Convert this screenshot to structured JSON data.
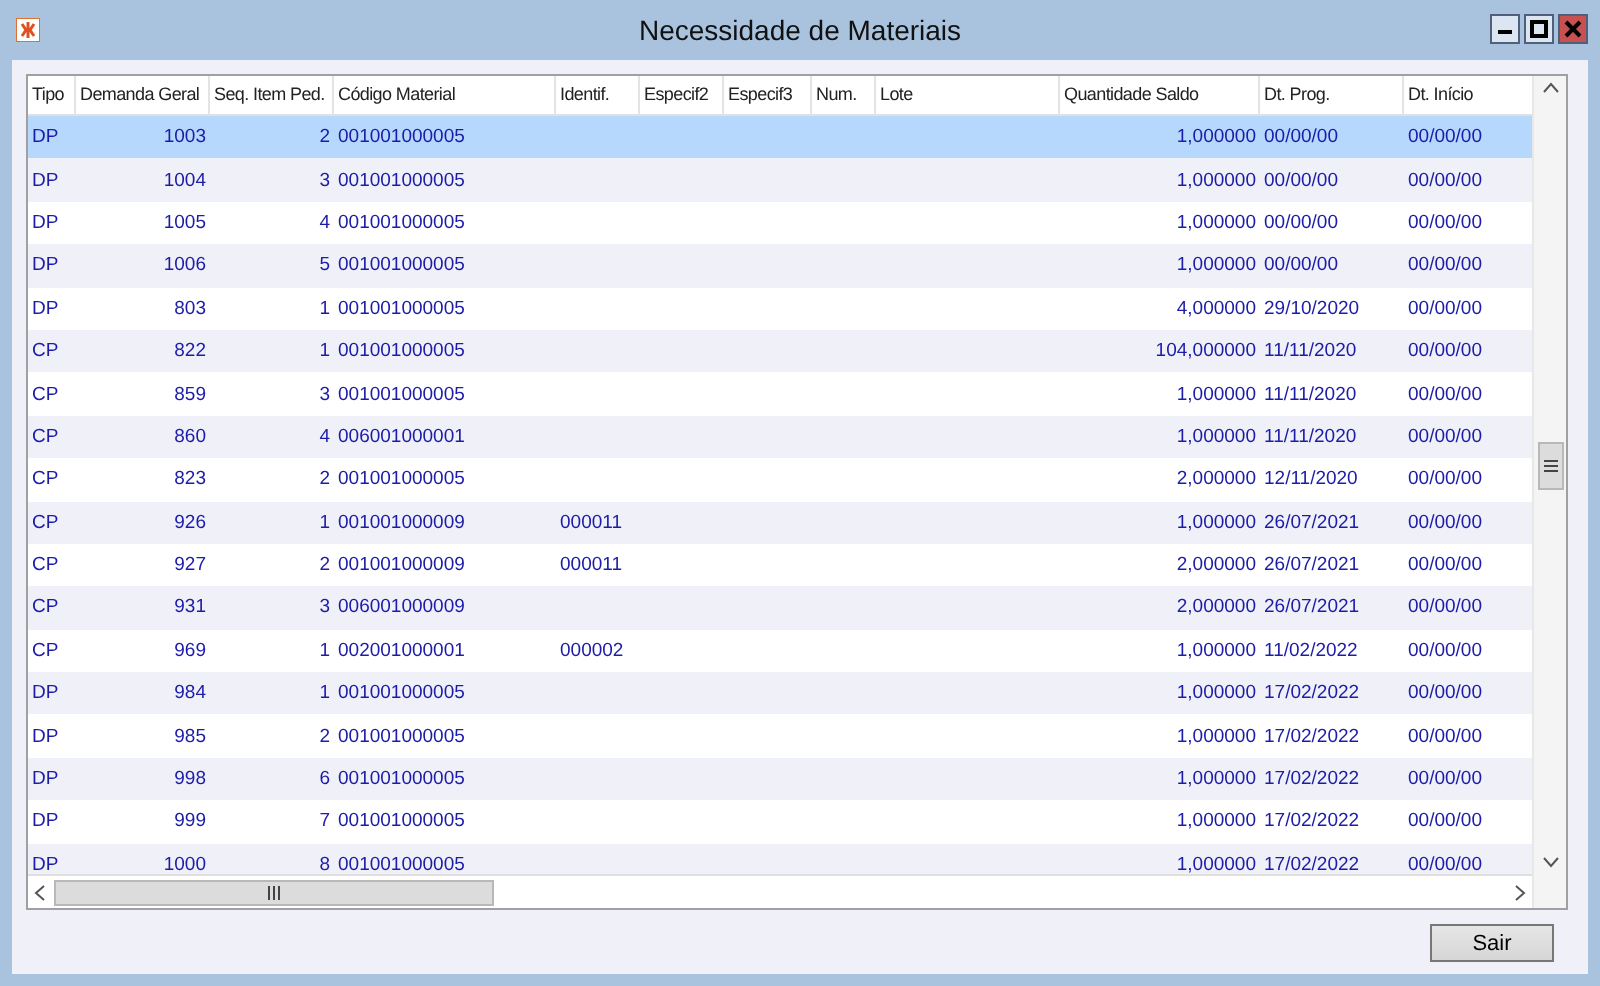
{
  "window": {
    "title": "Necessidade de Materiais"
  },
  "table": {
    "columns": [
      "Tipo",
      "Demanda Geral",
      "Seq. Item Ped.",
      "Código Material",
      "Identif.",
      "Especif2",
      "Especif3",
      "Num.",
      "Lote",
      "Quantidade Saldo",
      "Dt. Prog.",
      "Dt. Início"
    ],
    "rows": [
      {
        "selected": true,
        "tipo": "DP",
        "demanda_geral": "1003",
        "seq_item_ped": "2",
        "codigo_material": "001001000005",
        "quantidade_saldo": "1,000000",
        "dt_prog": "00/00/00",
        "dt_inicio": "00/00/00"
      },
      {
        "selected": false,
        "tipo": "DP",
        "demanda_geral": "1004",
        "seq_item_ped": "3",
        "codigo_material": "001001000005",
        "quantidade_saldo": "1,000000",
        "dt_prog": "00/00/00",
        "dt_inicio": "00/00/00"
      },
      {
        "selected": false,
        "tipo": "DP",
        "demanda_geral": "1005",
        "seq_item_ped": "4",
        "codigo_material": "001001000005",
        "quantidade_saldo": "1,000000",
        "dt_prog": "00/00/00",
        "dt_inicio": "00/00/00"
      },
      {
        "selected": false,
        "tipo": "DP",
        "demanda_geral": "1006",
        "seq_item_ped": "5",
        "codigo_material": "001001000005",
        "quantidade_saldo": "1,000000",
        "dt_prog": "00/00/00",
        "dt_inicio": "00/00/00"
      },
      {
        "selected": false,
        "tipo": "DP",
        "demanda_geral": "803",
        "seq_item_ped": "1",
        "codigo_material": "001001000005",
        "quantidade_saldo": "4,000000",
        "dt_prog": "29/10/2020",
        "dt_inicio": "00/00/00"
      },
      {
        "selected": false,
        "tipo": "CP",
        "demanda_geral": "822",
        "seq_item_ped": "1",
        "codigo_material": "001001000005",
        "quantidade_saldo": "104,000000",
        "dt_prog": "11/11/2020",
        "dt_inicio": "00/00/00"
      },
      {
        "selected": false,
        "tipo": "CP",
        "demanda_geral": "859",
        "seq_item_ped": "3",
        "codigo_material": "001001000005",
        "quantidade_saldo": "1,000000",
        "dt_prog": "11/11/2020",
        "dt_inicio": "00/00/00"
      },
      {
        "selected": false,
        "tipo": "CP",
        "demanda_geral": "860",
        "seq_item_ped": "4",
        "codigo_material": "006001000001",
        "quantidade_saldo": "1,000000",
        "dt_prog": "11/11/2020",
        "dt_inicio": "00/00/00"
      },
      {
        "selected": false,
        "tipo": "CP",
        "demanda_geral": "823",
        "seq_item_ped": "2",
        "codigo_material": "001001000005",
        "quantidade_saldo": "2,000000",
        "dt_prog": "12/11/2020",
        "dt_inicio": "00/00/00"
      },
      {
        "selected": false,
        "tipo": "CP",
        "demanda_geral": "926",
        "seq_item_ped": "1",
        "codigo_material": "001001000009",
        "identif": "000011",
        "quantidade_saldo": "1,000000",
        "dt_prog": "26/07/2021",
        "dt_inicio": "00/00/00"
      },
      {
        "selected": false,
        "tipo": "CP",
        "demanda_geral": "927",
        "seq_item_ped": "2",
        "codigo_material": "001001000009",
        "identif": "000011",
        "quantidade_saldo": "2,000000",
        "dt_prog": "26/07/2021",
        "dt_inicio": "00/00/00"
      },
      {
        "selected": false,
        "tipo": "CP",
        "demanda_geral": "931",
        "seq_item_ped": "3",
        "codigo_material": "006001000009",
        "quantidade_saldo": "2,000000",
        "dt_prog": "26/07/2021",
        "dt_inicio": "00/00/00"
      },
      {
        "selected": false,
        "tipo": "CP",
        "demanda_geral": "969",
        "seq_item_ped": "1",
        "codigo_material": "002001000001",
        "identif": "000002",
        "quantidade_saldo": "1,000000",
        "dt_prog": "11/02/2022",
        "dt_inicio": "00/00/00"
      },
      {
        "selected": false,
        "tipo": "DP",
        "demanda_geral": "984",
        "seq_item_ped": "1",
        "codigo_material": "001001000005",
        "quantidade_saldo": "1,000000",
        "dt_prog": "17/02/2022",
        "dt_inicio": "00/00/00"
      },
      {
        "selected": false,
        "tipo": "DP",
        "demanda_geral": "985",
        "seq_item_ped": "2",
        "codigo_material": "001001000005",
        "quantidade_saldo": "1,000000",
        "dt_prog": "17/02/2022",
        "dt_inicio": "00/00/00"
      },
      {
        "selected": false,
        "tipo": "DP",
        "demanda_geral": "998",
        "seq_item_ped": "6",
        "codigo_material": "001001000005",
        "quantidade_saldo": "1,000000",
        "dt_prog": "17/02/2022",
        "dt_inicio": "00/00/00"
      },
      {
        "selected": false,
        "tipo": "DP",
        "demanda_geral": "999",
        "seq_item_ped": "7",
        "codigo_material": "001001000005",
        "quantidade_saldo": "1,000000",
        "dt_prog": "17/02/2022",
        "dt_inicio": "00/00/00"
      },
      {
        "selected": false,
        "tipo": "DP",
        "demanda_geral": "1000",
        "seq_item_ped": "8",
        "codigo_material": "001001000005",
        "quantidade_saldo": "1,000000",
        "dt_prog": "17/02/2022",
        "dt_inicio": "00/00/00"
      }
    ]
  },
  "buttons": [
    "Sair"
  ]
}
